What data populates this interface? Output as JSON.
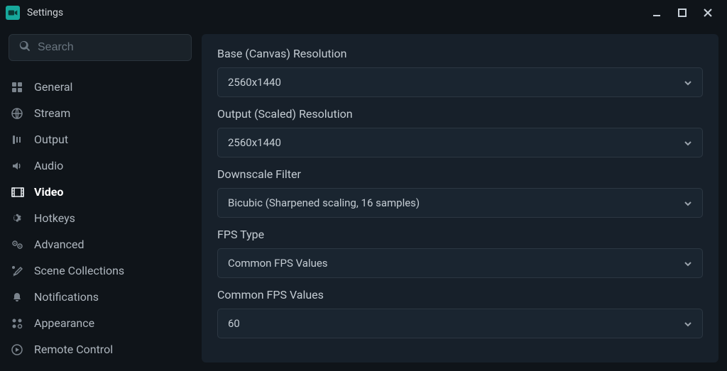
{
  "window": {
    "title": "Settings"
  },
  "search": {
    "placeholder": "Search",
    "value": ""
  },
  "sidebar": {
    "items": [
      {
        "label": "General"
      },
      {
        "label": "Stream"
      },
      {
        "label": "Output"
      },
      {
        "label": "Audio"
      },
      {
        "label": "Video"
      },
      {
        "label": "Hotkeys"
      },
      {
        "label": "Advanced"
      },
      {
        "label": "Scene Collections"
      },
      {
        "label": "Notifications"
      },
      {
        "label": "Appearance"
      },
      {
        "label": "Remote Control"
      }
    ],
    "active_index": 4
  },
  "main": {
    "fields": [
      {
        "label": "Base (Canvas) Resolution",
        "value": "2560x1440"
      },
      {
        "label": "Output (Scaled) Resolution",
        "value": "2560x1440"
      },
      {
        "label": "Downscale Filter",
        "value": "Bicubic (Sharpened scaling, 16 samples)"
      },
      {
        "label": "FPS Type",
        "value": "Common FPS Values"
      },
      {
        "label": "Common FPS Values",
        "value": "60"
      }
    ]
  }
}
